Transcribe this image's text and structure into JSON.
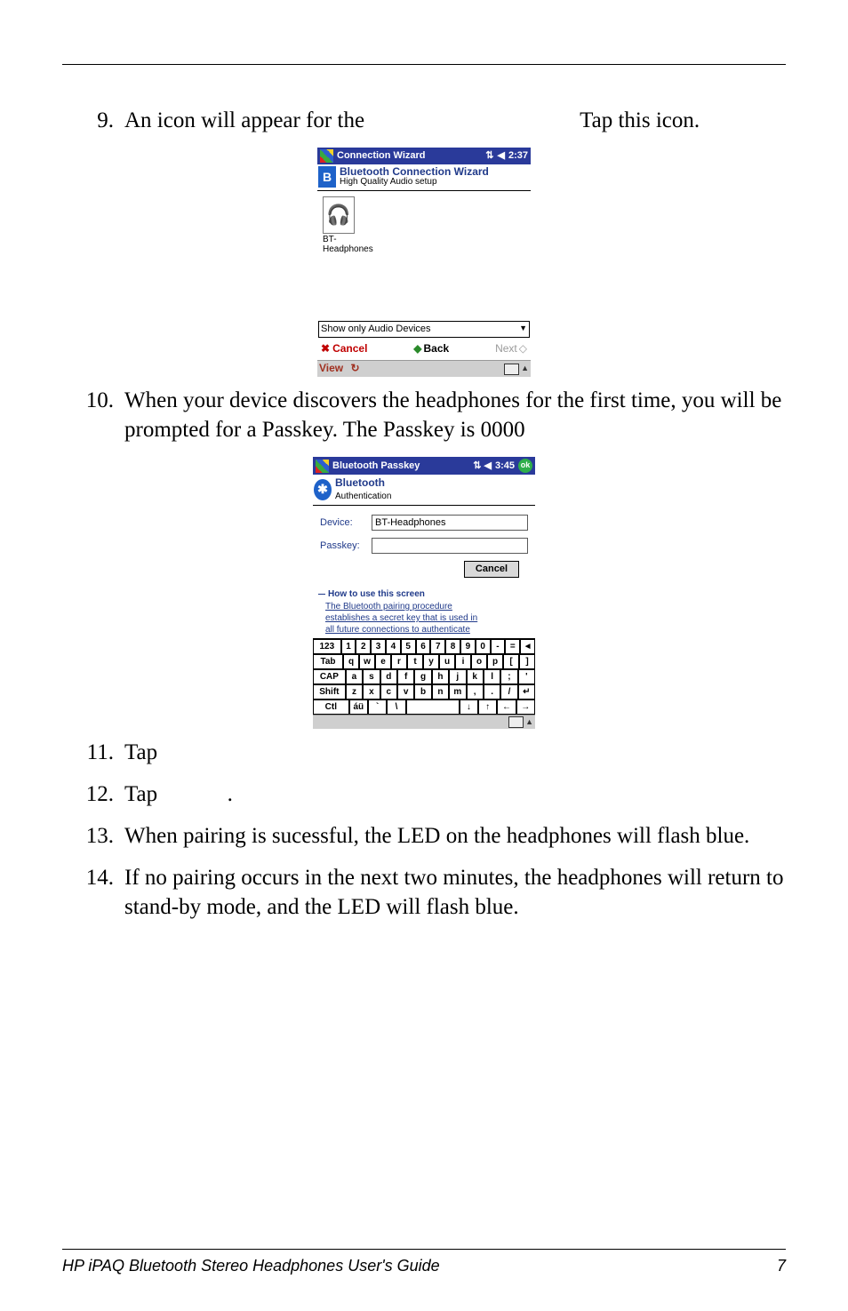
{
  "steps": {
    "s9": {
      "num": "9.",
      "text_a": "An icon will appear for the",
      "text_b": "Tap this icon."
    },
    "s10": {
      "num": "10.",
      "text": "When your device discovers the headphones for the first time, you will be prompted for a Passkey. The Passkey is 0000"
    },
    "s11": {
      "num": "11.",
      "text": "Tap"
    },
    "s12": {
      "num": "12.",
      "text_a": "Tap",
      "text_b": "."
    },
    "s13": {
      "num": "13.",
      "text": "When pairing is sucessful, the LED on the headphones will flash blue."
    },
    "s14": {
      "num": "14.",
      "text": "If no pairing occurs in the next two minutes, the headphones will return to stand-by mode, and the LED will flash blue."
    }
  },
  "cw": {
    "titlebar": {
      "app": "Connection Wizard",
      "time": "2:37"
    },
    "header": {
      "line1": "Bluetooth Connection Wizard",
      "line2": "High Quality Audio setup"
    },
    "icon_caption_l1": "BT-",
    "icon_caption_l2": "Headphones",
    "dropdown": "Show only Audio Devices",
    "nav": {
      "cancel": "Cancel",
      "back": "Back",
      "next": "Next"
    },
    "bottom": {
      "view": "View"
    }
  },
  "pk": {
    "titlebar": {
      "app": "Bluetooth Passkey",
      "time": "3:45",
      "ok": "ok"
    },
    "header": {
      "line1": "Bluetooth",
      "line2": "Authentication"
    },
    "form": {
      "device_label": "Device:",
      "device_value": "BT-Headphones",
      "passkey_label": "Passkey:",
      "passkey_value": ""
    },
    "cancel": "Cancel",
    "section": "How to use this screen",
    "help_l1": "The Bluetooth pairing procedure",
    "help_l2": "establishes a secret key that is used in",
    "help_l3": "all future connections to authenticate",
    "osk": {
      "r1": [
        "123",
        "1",
        "2",
        "3",
        "4",
        "5",
        "6",
        "7",
        "8",
        "9",
        "0",
        "-",
        "=",
        "◄"
      ],
      "r2": [
        "Tab",
        "q",
        "w",
        "e",
        "r",
        "t",
        "y",
        "u",
        "i",
        "o",
        "p",
        "[",
        "]"
      ],
      "r3": [
        "CAP",
        "a",
        "s",
        "d",
        "f",
        "g",
        "h",
        "j",
        "k",
        "l",
        ";",
        "'"
      ],
      "r4": [
        "Shift",
        "z",
        "x",
        "c",
        "v",
        "b",
        "n",
        "m",
        ",",
        ".",
        "/",
        "↵"
      ],
      "r5": [
        "Ctl",
        "áü",
        "`",
        "\\",
        "",
        "↓",
        "↑",
        "←",
        "→"
      ]
    }
  },
  "footer": {
    "title": "HP iPAQ Bluetooth Stereo Headphones User's Guide",
    "page": "7"
  }
}
